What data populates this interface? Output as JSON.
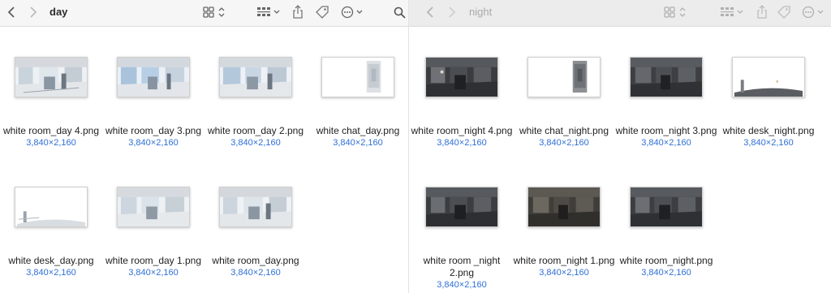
{
  "left_window": {
    "folder": "day",
    "icons": {
      "back": "chevron-left-icon",
      "forward": "chevron-right-icon",
      "view": "grid-view-icon",
      "group": "group-by-icon",
      "share": "share-icon",
      "tag": "tag-icon",
      "more": "ellipsis-icon",
      "search": "search-icon"
    },
    "files": [
      {
        "name": "white room_day 4.png",
        "dims": "3,840×2,160"
      },
      {
        "name": "white room_day 3.png",
        "dims": "3,840×2,160"
      },
      {
        "name": "white room_day 2.png",
        "dims": "3,840×2,160"
      },
      {
        "name": "white chat_day.png",
        "dims": "3,840×2,160"
      },
      {
        "name": "white desk_day.png",
        "dims": "3,840×2,160"
      },
      {
        "name": "white room_day 1.png",
        "dims": "3,840×2,160"
      },
      {
        "name": "white room_day.png",
        "dims": "3,840×2,160"
      }
    ]
  },
  "right_window": {
    "folder": "night",
    "icons": {
      "back": "chevron-left-icon",
      "forward": "chevron-right-icon",
      "view": "grid-view-icon",
      "group": "group-by-icon",
      "share": "share-icon",
      "tag": "tag-icon",
      "more": "ellipsis-icon"
    },
    "files": [
      {
        "name": "white room_night 4.png",
        "dims": "3,840×2,160"
      },
      {
        "name": "white chat_night.png",
        "dims": "3,840×2,160"
      },
      {
        "name": "white room_night 3.png",
        "dims": "3,840×2,160"
      },
      {
        "name": "white desk_night.png",
        "dims": "3,840×2,160"
      },
      {
        "name": "white room _night 2.png",
        "dims": "3,840×2,160"
      },
      {
        "name": "white room_night 1.png",
        "dims": "3,840×2,160"
      },
      {
        "name": "white room_night.png",
        "dims": "3,840×2,160"
      }
    ]
  },
  "colors": {
    "dimension_text": "#2e6fd6",
    "left_toolbar": "#f6f6f6",
    "right_toolbar": "#ececec"
  }
}
